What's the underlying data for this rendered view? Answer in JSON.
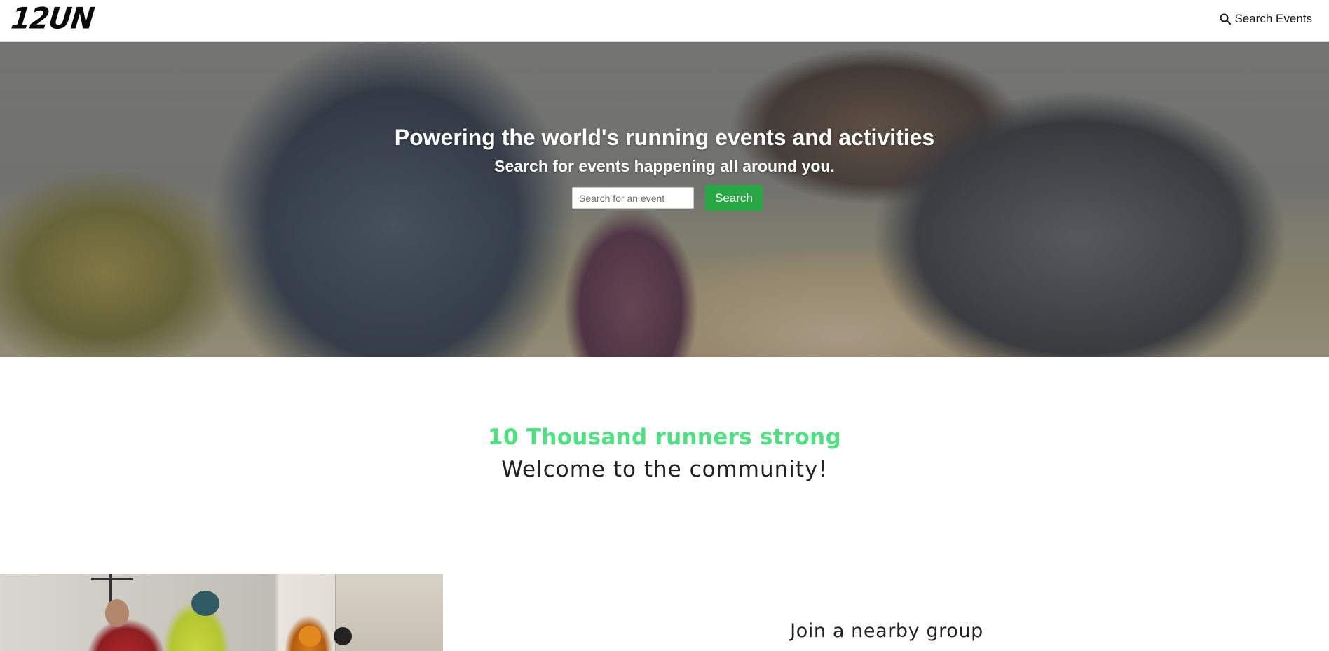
{
  "header": {
    "logo_text": "12UN",
    "search_link": "Search Events",
    "search_icon": "search-icon"
  },
  "hero": {
    "title": "Powering the world's running events and activities",
    "subtitle": "Search for events happening all around you.",
    "search_placeholder": "Search for an event",
    "search_button": "Search",
    "button_color": "#28a745"
  },
  "community": {
    "stat": "10 Thousand runners strong",
    "stat_color": "#4ee081",
    "welcome": "Welcome to the community!"
  },
  "groups": {
    "heading": "Join a nearby group"
  }
}
